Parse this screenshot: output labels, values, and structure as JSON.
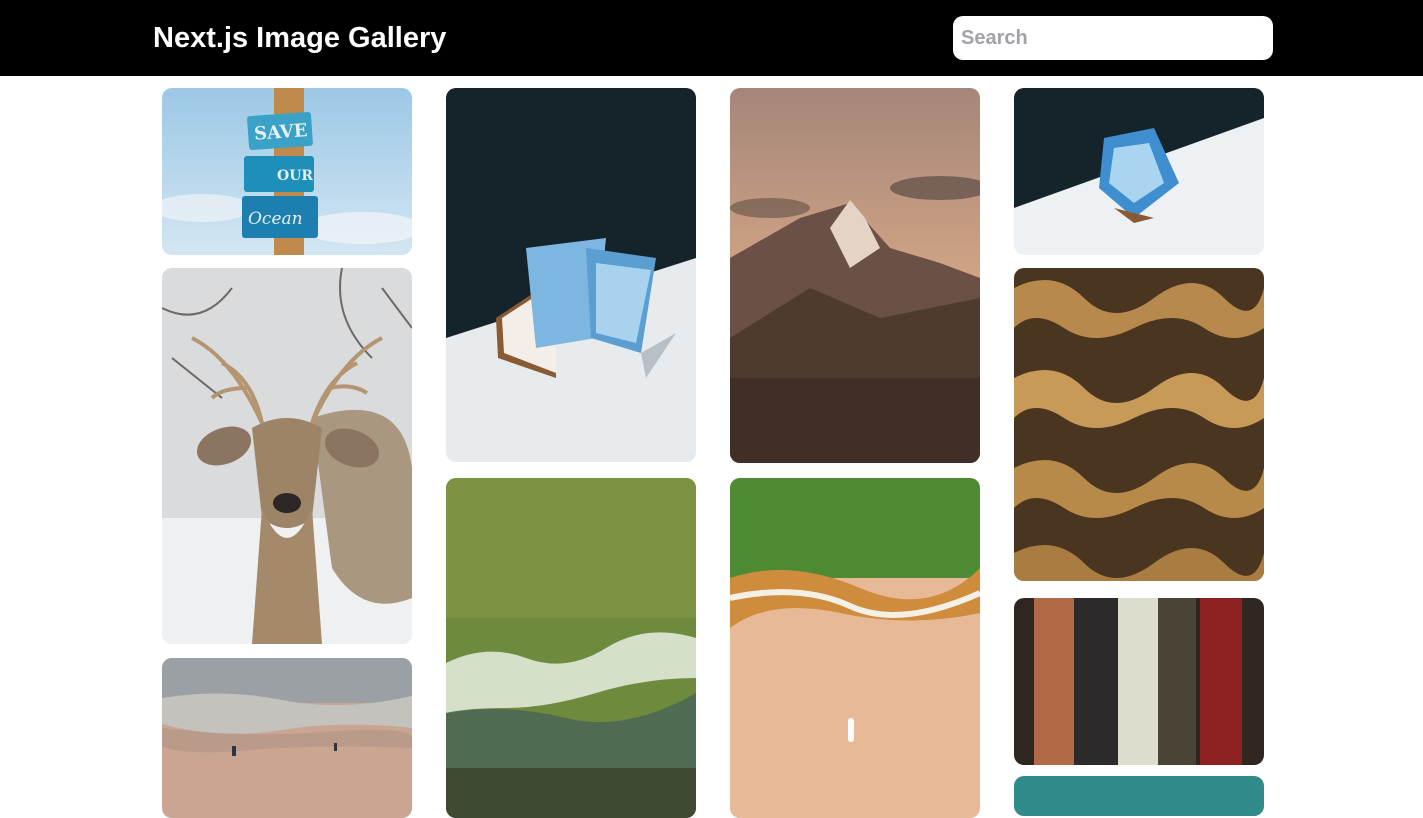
{
  "header": {
    "title": "Next.js Image Gallery",
    "search_placeholder": "Search"
  },
  "gallery": {
    "images": [
      {
        "subject": "signpost-save-our-ocean",
        "sign_lines": [
          "SAVE",
          "OUR",
          "Ocean"
        ]
      },
      {
        "subject": "deer-in-snow"
      },
      {
        "subject": "beach-shoreline-people"
      },
      {
        "subject": "open-book-blue-paper"
      },
      {
        "subject": "aerial-green-ocean-waves"
      },
      {
        "subject": "mountain-sunset"
      },
      {
        "subject": "aerial-beach-surfer"
      },
      {
        "subject": "folded-paper-on-white"
      },
      {
        "subject": "wavy-wooden-shadows"
      },
      {
        "subject": "hanging-fabrics"
      },
      {
        "subject": "teal-image-partial"
      }
    ]
  },
  "colors": {
    "header_bg": "#000000",
    "page_bg": "#ffffff",
    "title_text": "#ffffff"
  }
}
